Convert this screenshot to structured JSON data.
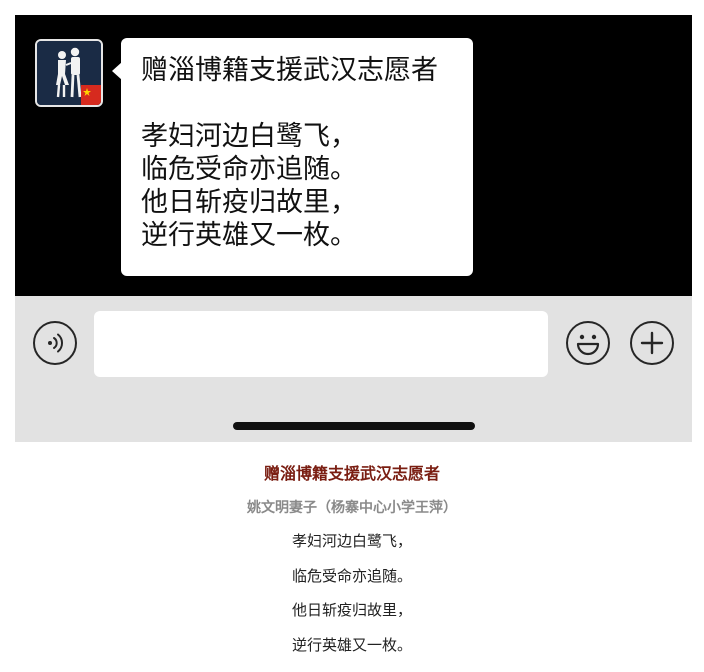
{
  "chat": {
    "message": {
      "title": "赠淄博籍支援武汉志愿者",
      "lines": [
        "孝妇河边白鹭飞，",
        "临危受命亦追随。",
        "他日斩疫归故里，",
        "逆行英雄又一枚。"
      ]
    }
  },
  "input_bar": {
    "icons": {
      "voice": "voice-icon",
      "emoji": "emoji-icon",
      "plus": "plus-icon"
    }
  },
  "article": {
    "title": "赠淄博籍支援武汉志愿者",
    "author": "姚文明妻子（杨寨中心小学王萍）",
    "lines": [
      "孝妇河边白鹭飞，",
      "临危受命亦追随。",
      "他日斩疫归故里，",
      "逆行英雄又一枚。"
    ]
  },
  "colors": {
    "chat_bg": "#000000",
    "bubble": "#ffffff",
    "input_bar_bg": "#e2e2e2",
    "title": "#7a1e12",
    "author": "#8a8a8a"
  }
}
